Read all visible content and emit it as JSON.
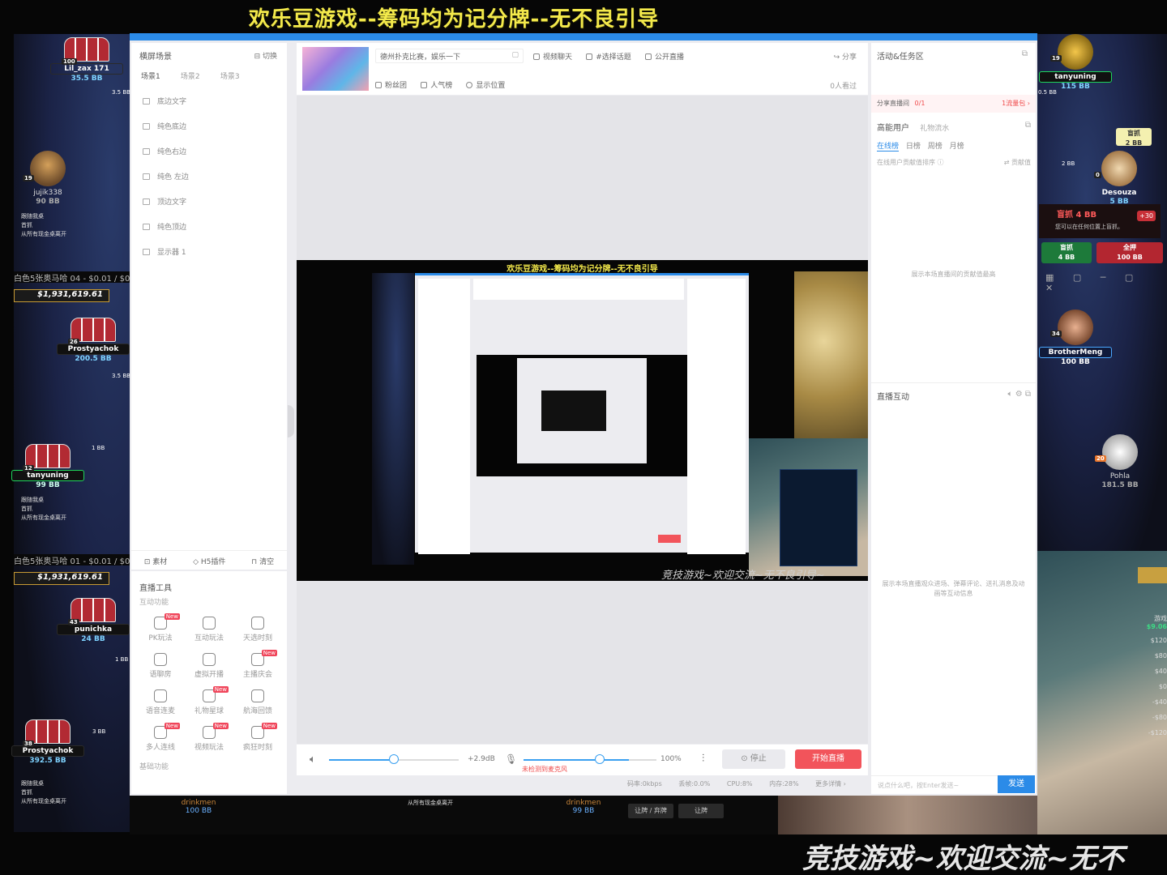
{
  "overlay": {
    "top_banner": "欢乐豆游戏--筹码均为记分牌--无不良引导",
    "bottom_banner": "竞技游戏~欢迎交流~无不",
    "preview_banner": "欢乐豆游戏--筹码均为记分牌--无不良引导",
    "preview_footer": "竞技游戏~欢迎交流~无不良引导~"
  },
  "poker": {
    "left_players": [
      {
        "name": "Lil_zax 171",
        "bb": "35.5 BB",
        "level": "100"
      },
      {
        "name": "jujik338",
        "bb": "90 BB",
        "level": "19"
      },
      {
        "name": "Prostyachok",
        "bb": "200.5 BB",
        "level": "26"
      },
      {
        "name": "tanyuning",
        "bb": "99 BB",
        "level": "12"
      },
      {
        "name": "punichka",
        "bb": "24 BB",
        "level": "43"
      },
      {
        "name": "Prostyachok",
        "bb": "392.5 BB",
        "level": "38"
      }
    ],
    "right_players": [
      {
        "name": "tanyuning",
        "bb": "115 BB",
        "level": "19"
      },
      {
        "name": "Desouza",
        "bb": "5 BB",
        "level": "0"
      },
      {
        "name": "BrotherMeng",
        "bb": "100 BB",
        "level": "34"
      },
      {
        "name": "Pohla",
        "bb": "181.5 BB",
        "level": "20"
      }
    ],
    "bottom_players": [
      {
        "name": "drinkmen",
        "bb": "100 BB"
      },
      {
        "name": "drinkmen",
        "bb": "99 BB"
      }
    ],
    "chips": [
      "3.5 BB",
      "3.5 BB",
      "1 BB",
      "1 BB",
      "3 BB",
      "0.5 BB",
      "2 BB",
      "2 BB"
    ],
    "table_strips": [
      "白色5张奥马哈 04 - $0.01 / $0",
      "白色5张奥马哈 01 - $0.01 / $0"
    ],
    "jackpots": [
      "$1,931,619.61",
      "$1,931,619.61"
    ],
    "notices": [
      "跟随我桌",
      "首抓",
      "从所有现金桌离开"
    ],
    "raise": {
      "title": "盲抓 4 BB",
      "sub": "您可以在任何位置上盲抓。",
      "plus": "+30",
      "btn1_a": "盲抓",
      "btn1_b": "4 BB",
      "btn2_a": "全押",
      "btn2_b": "100 BB"
    },
    "right_tip": {
      "a": "盲抓",
      "b": "2 BB"
    },
    "action_btns": [
      "让牌 / 弃牌",
      "让牌"
    ],
    "right_side_amounts": [
      "游戏",
      "$9.06",
      "$120",
      "$80",
      "$40",
      "$0",
      "-$40",
      "-$80",
      "-$120"
    ]
  },
  "app": {
    "left": {
      "title": "横屏场景",
      "switch": "切换",
      "scene_tabs": [
        "场景1",
        "场景2",
        "场景3"
      ],
      "sources": [
        "底边文字",
        "纯色底边",
        "纯色右边",
        "纯色 左边",
        "顶边文字",
        "纯色顶边",
        "显示器 1"
      ],
      "bottom_actions": [
        "素材",
        "H5插件",
        "清空"
      ]
    },
    "tools": {
      "title": "直播工具",
      "section1": "互动功能",
      "items": [
        {
          "label": "PK玩法",
          "new": "New"
        },
        {
          "label": "互动玩法",
          "new": ""
        },
        {
          "label": "天选时刻",
          "new": ""
        },
        {
          "label": "语聊房",
          "new": ""
        },
        {
          "label": "虚拟开播",
          "new": ""
        },
        {
          "label": "主播庆会",
          "new": "New"
        },
        {
          "label": "语音连麦",
          "new": ""
        },
        {
          "label": "礼物星球",
          "new": "New"
        },
        {
          "label": "航海回馈",
          "new": ""
        },
        {
          "label": "多人连线",
          "new": "New"
        },
        {
          "label": "视频玩法",
          "new": "New"
        },
        {
          "label": "疯狂时刻",
          "new": "New"
        }
      ],
      "section2": "基础功能"
    },
    "header": {
      "room_title": "德州扑克比赛，娱乐一下",
      "category": "视频聊天",
      "topic": "#选择话题",
      "public": "公开直播",
      "share": "分享",
      "fans": "粉丝团",
      "popularity": "人气榜",
      "location": "显示位置",
      "viewers": "0人看过"
    },
    "controls": {
      "volume_db": "+2.9dB",
      "mic_percent": "100%",
      "mic_warning": "未检测到麦克风",
      "stop": "停止",
      "start": "开始直播",
      "volume_level": 0.5,
      "mic_level": 0.79
    },
    "status": {
      "bitrate": "码率:0kbps",
      "dropped": "丢帧:0.0%",
      "cpu": "CPU:8%",
      "memory": "内存:28%",
      "more": "更多详情"
    },
    "right": {
      "activity": "活动&任务区",
      "share_room": "分享直播间",
      "share_count": "0/1",
      "share_reward": "1流量包",
      "tab_users": "高能用户",
      "tab_gifts": "礼物流水",
      "rank_tabs": [
        "在线榜",
        "日榜",
        "周榜",
        "月榜"
      ],
      "rank_desc": "在线用户贡献值排序",
      "rank_value": "贡献值",
      "rank_empty": "展示本场直播间的贡献值最高",
      "interact": "直播互动",
      "interact_empty": "展示本场直播观众进场、弹幕评论、送礼消息及动画等互动信息",
      "chat_placeholder": "说点什么吧，按Enter发送~",
      "send": "发送"
    }
  }
}
